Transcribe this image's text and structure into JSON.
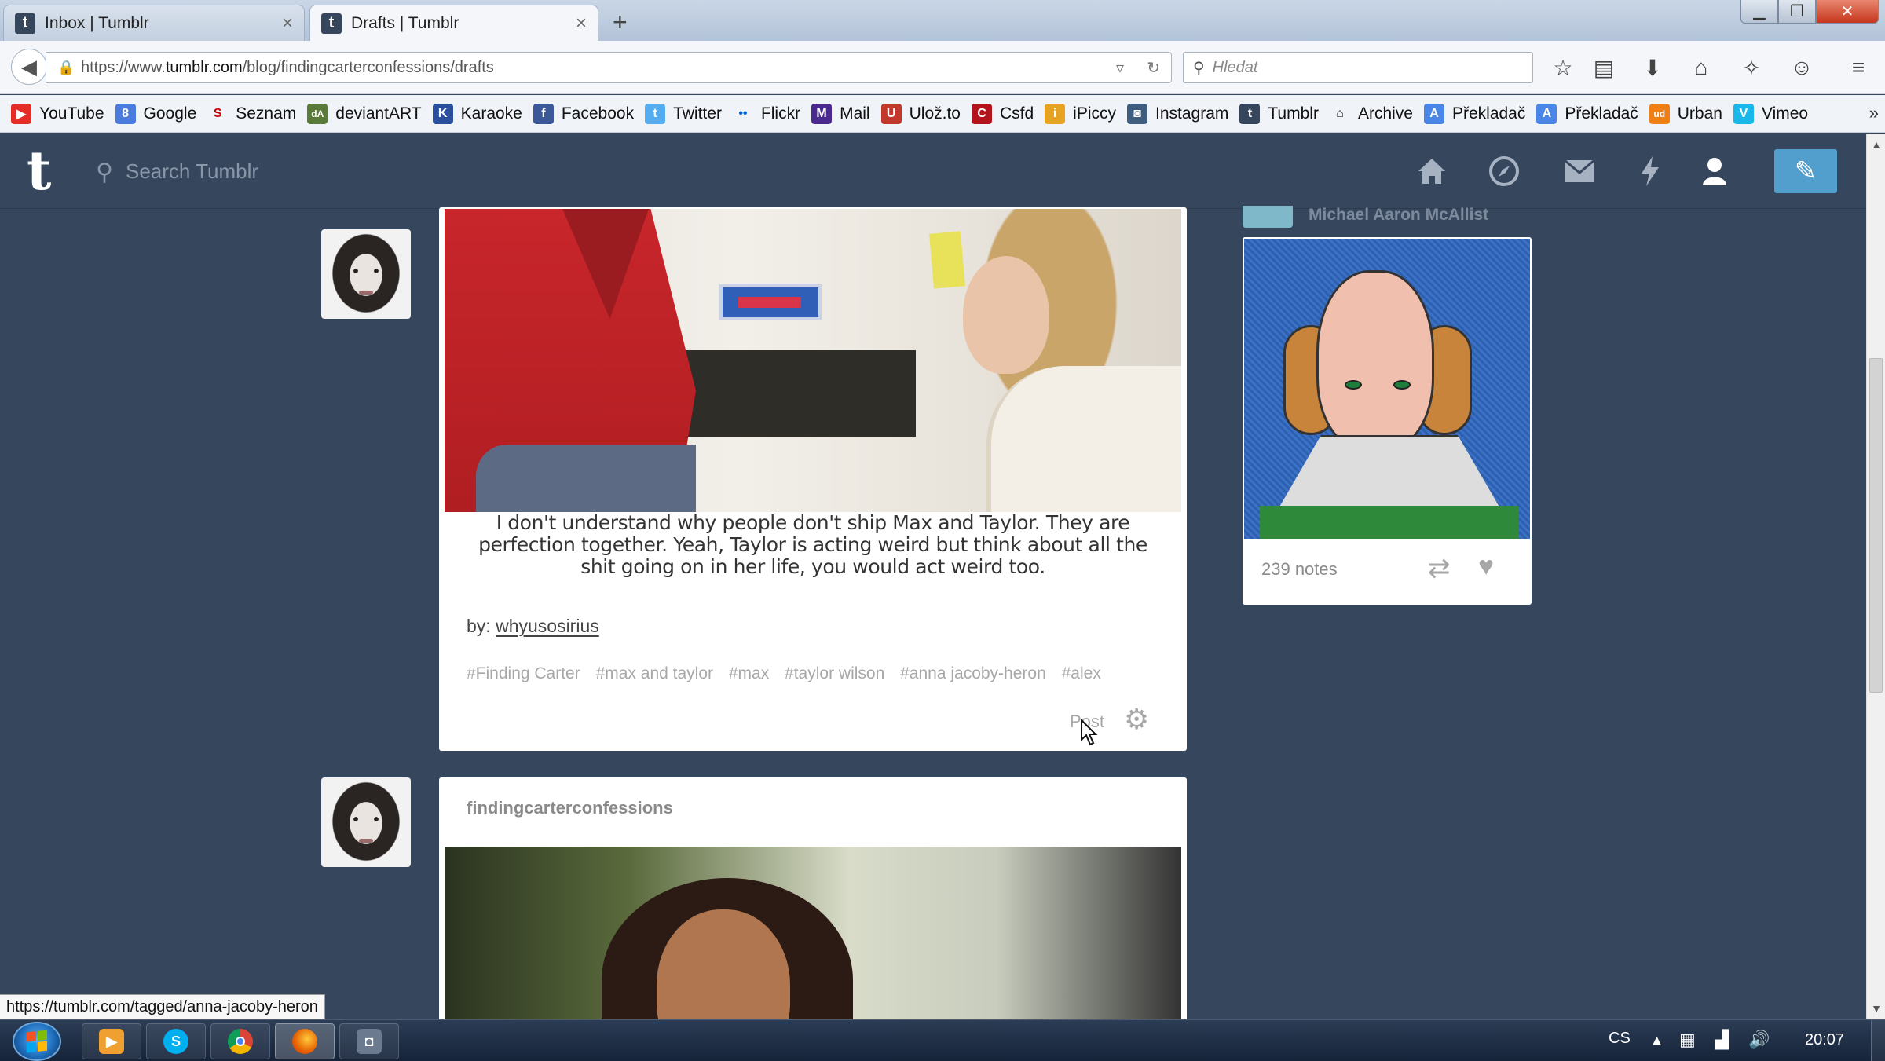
{
  "browser": {
    "tabs": [
      {
        "title": "Inbox | Tumblr",
        "favicon": "t",
        "active": false
      },
      {
        "title": "Drafts | Tumblr",
        "favicon": "t",
        "active": true
      }
    ],
    "new_tab_icon": "+",
    "window_controls": {
      "minimize": "▁",
      "maximize": "❐",
      "close": "✕"
    },
    "url_prefix": "https://www.",
    "url_domain": "tumblr.com",
    "url_path": "/blog/findingcarterconfessions/drafts",
    "search_placeholder": "Hledat",
    "toolbar_icons": [
      "star-icon",
      "reading-list-icon",
      "download-icon",
      "home-icon",
      "addon-icon",
      "chat-icon",
      "menu-icon"
    ],
    "bookmarks": [
      {
        "label": "YouTube",
        "color": "#e52d27",
        "glyph": "▶"
      },
      {
        "label": "Google",
        "color": "#4a7ce0",
        "glyph": "8"
      },
      {
        "label": "Seznam",
        "color": "#cc0000",
        "glyph": "S"
      },
      {
        "label": "deviantART",
        "color": "#5a7a3a",
        "glyph": "dA"
      },
      {
        "label": "Karaoke",
        "color": "#2a4f9e",
        "glyph": "K"
      },
      {
        "label": "Facebook",
        "color": "#3b5998",
        "glyph": "f"
      },
      {
        "label": "Twitter",
        "color": "#55acee",
        "glyph": "t"
      },
      {
        "label": "Flickr",
        "color": "#0063dc",
        "glyph": "••"
      },
      {
        "label": "Mail",
        "color": "#4b2a8f",
        "glyph": "M"
      },
      {
        "label": "Ulož.to",
        "color": "#c0392b",
        "glyph": "U"
      },
      {
        "label": "Csfd",
        "color": "#b3131b",
        "glyph": "C"
      },
      {
        "label": "iPiccy",
        "color": "#e6a221",
        "glyph": "i"
      },
      {
        "label": "Instagram",
        "color": "#3f5e7f",
        "glyph": "◙"
      },
      {
        "label": "Tumblr",
        "color": "#36465d",
        "glyph": "t"
      },
      {
        "label": "Archive",
        "color": "#222222",
        "glyph": "A"
      },
      {
        "label": "Překladač",
        "color": "#4a86e8",
        "glyph": "A"
      },
      {
        "label": "Překladač",
        "color": "#4a86e8",
        "glyph": "A"
      },
      {
        "label": "Urban",
        "color": "#f07f13",
        "glyph": "ud"
      },
      {
        "label": "Vimeo",
        "color": "#1ab7ea",
        "glyph": "V"
      }
    ],
    "bookmarks_more": "»",
    "status_url": "https://tumblr.com/tagged/anna-jacoby-heron"
  },
  "tumblr": {
    "logo": "t",
    "search_placeholder": "Search Tumblr",
    "nav_icons": [
      "home-icon",
      "explore-icon",
      "inbox-icon",
      "activity-icon",
      "account-icon"
    ],
    "compose_icon": "✎"
  },
  "posts": [
    {
      "caption": "I don't understand why people don't ship Max and Taylor. They are perfection together. Yeah, Taylor is acting weird but think about all the shit going on in her life, you would act weird too.",
      "by_label": "by:",
      "by_user": "whyusosirius",
      "tags": [
        "#Finding Carter",
        "#max and taylor",
        "#max",
        "#taylor wilson",
        "#anna jacoby-heron",
        "#alex"
      ],
      "post_action": "Post"
    },
    {
      "blog_name": "findingcarterconfessions"
    }
  ],
  "radar": {
    "blog_name": "Michael Aaron McAllist",
    "notes": "239 notes"
  },
  "taskbar": {
    "apps": [
      {
        "name": "media-player",
        "color": "#f0a030",
        "glyph": "▶"
      },
      {
        "name": "skype",
        "color": "#00aff0",
        "glyph": "S"
      },
      {
        "name": "chrome",
        "color": "#db4437",
        "glyph": "◉"
      },
      {
        "name": "firefox",
        "color": "#e66000",
        "glyph": "◐"
      },
      {
        "name": "camera",
        "color": "#6b7a8f",
        "glyph": "◘"
      }
    ],
    "language": "CS",
    "clock": "20:07"
  }
}
